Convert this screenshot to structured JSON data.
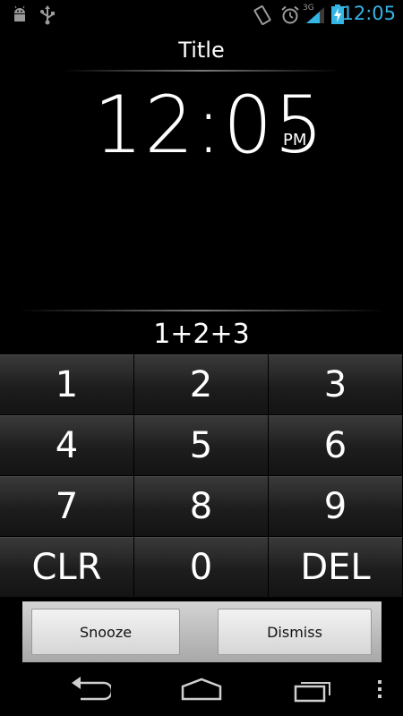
{
  "status_bar": {
    "time": "12:05",
    "network": "3G",
    "icons": [
      "android-debug-icon",
      "usb-icon",
      "rotation-lock-icon",
      "alarm-icon",
      "signal-icon",
      "battery-charging-icon"
    ],
    "accent_color": "#33b5e5"
  },
  "header": {
    "title": "Title"
  },
  "clock": {
    "time": "12:05",
    "ampm": "PM"
  },
  "challenge": {
    "expression": "1+2+3"
  },
  "keypad": {
    "keys": [
      "1",
      "2",
      "3",
      "4",
      "5",
      "6",
      "7",
      "8",
      "9",
      "CLR",
      "0",
      "DEL"
    ]
  },
  "actions": {
    "snooze_label": "Snooze",
    "dismiss_label": "Dismiss"
  },
  "navigation": {
    "items": [
      "back-icon",
      "home-icon",
      "recent-apps-icon",
      "overflow-menu-icon"
    ]
  }
}
